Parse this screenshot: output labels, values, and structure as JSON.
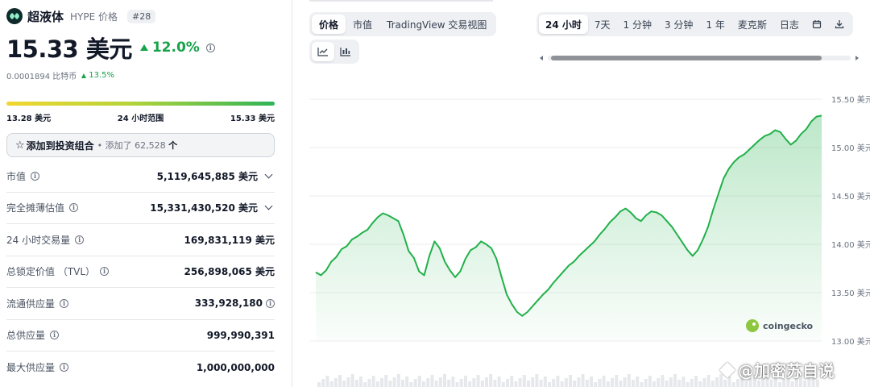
{
  "coin": {
    "name": "超液体",
    "symbol_label": "HYPE 价格",
    "rank": "#28",
    "price": "15.33 美元",
    "change_24h": "12.0%",
    "btc_price": "0.0001894 比特币",
    "btc_change": "13.5%"
  },
  "range_24h": {
    "low": "13.28 美元",
    "label": "24 小时范围",
    "high": "15.33 美元"
  },
  "portfolio": {
    "label": "添加到投资组合",
    "added_prefix": "• 添加了",
    "count": "62,528",
    "suffix": "个"
  },
  "stats": [
    {
      "label": "市值",
      "value": "5,119,645,885 美元",
      "expand": true
    },
    {
      "label": "完全摊薄估值",
      "value": "15,331,430,520 美元",
      "expand": true
    },
    {
      "label": "24 小时交易量",
      "value": "169,831,119 美元",
      "expand": false
    },
    {
      "label": "总锁定价值 （TVL）",
      "value": "256,898,065 美元",
      "expand": false
    },
    {
      "label": "流通供应量",
      "value": "333,928,180",
      "expand": false
    },
    {
      "label": "总供应量",
      "value": "999,990,391",
      "expand": false
    },
    {
      "label": "最大供应量",
      "value": "1,000,000,000",
      "expand": false
    }
  ],
  "chart_tabs": [
    "价格",
    "市值",
    "TradingView 交易视图"
  ],
  "range_tabs": [
    "24 小时",
    "7天",
    "1 分钟",
    "3 分钟",
    "1 年",
    "麦克斯",
    "日志"
  ],
  "icons": {
    "calendar": "calendar-icon",
    "download": "download-icon",
    "line": "line-chart-icon",
    "candle": "candlestick-icon"
  },
  "colors": {
    "up": "#16a34a",
    "line": "#22b04a"
  },
  "chart_data": {
    "type": "area",
    "ylim": [
      13.0,
      15.5
    ],
    "y_ticks": [
      "15.50 美元",
      "15.00 美元",
      "14.50 美元",
      "14.00 美元",
      "13.50 美元",
      "13.00 美元"
    ],
    "y_tick_values": [
      15.5,
      15.0,
      14.5,
      14.0,
      13.5,
      13.0
    ],
    "series": [
      {
        "values": [
          13.71,
          13.68,
          13.73,
          13.82,
          13.87,
          13.95,
          13.98,
          14.05,
          14.08,
          14.12,
          14.15,
          14.22,
          14.28,
          14.32,
          14.3,
          14.27,
          14.24,
          14.1,
          13.93,
          13.86,
          13.72,
          13.68,
          13.88,
          14.03,
          13.96,
          13.82,
          13.73,
          13.66,
          13.72,
          13.85,
          13.94,
          13.97,
          14.03,
          14.0,
          13.96,
          13.85,
          13.66,
          13.48,
          13.38,
          13.3,
          13.26,
          13.3,
          13.36,
          13.42,
          13.48,
          13.53,
          13.6,
          13.66,
          13.72,
          13.78,
          13.82,
          13.88,
          13.93,
          13.98,
          14.03,
          14.1,
          14.16,
          14.23,
          14.28,
          14.34,
          14.37,
          14.33,
          14.27,
          14.24,
          14.3,
          14.34,
          14.33,
          14.3,
          14.24,
          14.18,
          14.1,
          14.02,
          13.94,
          13.88,
          13.94,
          14.05,
          14.18,
          14.36,
          14.52,
          14.68,
          14.78,
          14.85,
          14.9,
          14.93,
          14.98,
          15.03,
          15.08,
          15.12,
          15.14,
          15.18,
          15.16,
          15.09,
          15.03,
          15.07,
          15.14,
          15.19,
          15.27,
          15.32,
          15.33
        ]
      }
    ]
  },
  "watermark": {
    "brand": "coingecko",
    "overlay": "@加密苏自说"
  }
}
